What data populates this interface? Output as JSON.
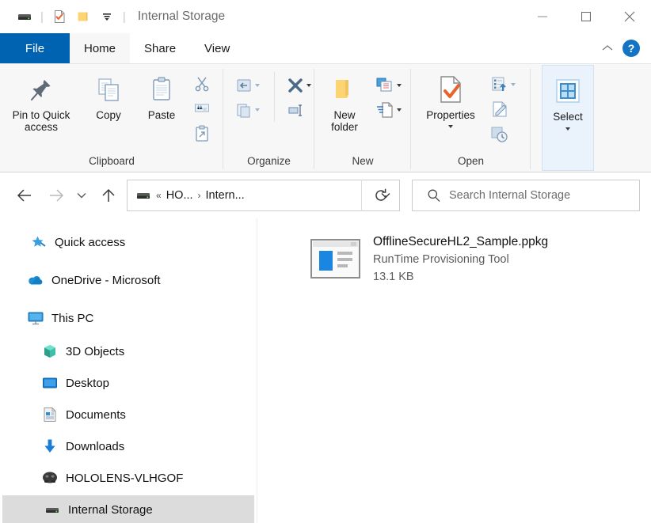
{
  "window": {
    "title": "Internal Storage",
    "controls": {
      "minimize": "minimize-button",
      "maximize": "maximize-button",
      "close": "close-button"
    }
  },
  "quick_access_toolbar": {
    "items": [
      {
        "name": "drive-icon",
        "label": "Internal Storage"
      },
      {
        "name": "properties-icon",
        "label": "Properties"
      },
      {
        "name": "new-folder-icon",
        "label": "New folder"
      },
      {
        "name": "customize-dropdown-icon",
        "label": "Customize Quick Access Toolbar"
      }
    ]
  },
  "ribbon": {
    "tabs": [
      {
        "label": "File",
        "active": false,
        "style": "file"
      },
      {
        "label": "Home",
        "active": true
      },
      {
        "label": "Share",
        "active": false
      },
      {
        "label": "View",
        "active": false
      }
    ],
    "collapse_label": "^",
    "help_label": "?",
    "groups": [
      {
        "label": "Clipboard",
        "big_buttons": [
          {
            "label": "Pin to Quick\naccess",
            "line1": "Pin to Quick",
            "line2": "access",
            "icon": "pin-icon"
          },
          {
            "label": "Copy",
            "icon": "copy-icon"
          },
          {
            "label": "Paste",
            "icon": "paste-icon"
          }
        ],
        "small_buttons": [
          {
            "label": "Cut",
            "icon": "cut-icon"
          },
          {
            "label": "Copy path",
            "icon": "copy-path-icon"
          },
          {
            "label": "Paste shortcut",
            "icon": "paste-shortcut-icon"
          }
        ]
      },
      {
        "label": "Organize",
        "small_buttons": [
          {
            "label": "Move to",
            "icon": "move-to-icon"
          },
          {
            "label": "Copy to",
            "icon": "copy-to-icon"
          },
          {
            "label": "Delete",
            "icon": "delete-icon"
          },
          {
            "label": "Rename",
            "icon": "rename-icon"
          }
        ]
      },
      {
        "label": "New",
        "big_buttons": [
          {
            "label": "New folder",
            "line1": "New",
            "line2": "folder",
            "icon": "new-folder-icon"
          }
        ],
        "small_buttons": [
          {
            "label": "New item",
            "icon": "new-item-icon"
          },
          {
            "label": "Easy access",
            "icon": "easy-access-icon"
          }
        ]
      },
      {
        "label": "Open",
        "big_buttons": [
          {
            "label": "Properties",
            "icon": "properties-icon"
          }
        ],
        "small_buttons": [
          {
            "label": "Open",
            "icon": "open-icon"
          },
          {
            "label": "Edit",
            "icon": "edit-icon"
          },
          {
            "label": "History",
            "icon": "history-icon"
          }
        ]
      },
      {
        "label": "",
        "highlighted": true,
        "big_buttons": [
          {
            "label": "Select",
            "icon": "select-icon"
          }
        ]
      }
    ]
  },
  "navigation": {
    "back_label": "Back",
    "forward_label": "Forward",
    "recent_label": "Recent locations",
    "up_label": "Up",
    "refresh_label": "Refresh",
    "breadcrumb": {
      "drive_icon": "drive-icon",
      "overflow": "«",
      "segments": [
        "HO...",
        "Intern..."
      ],
      "separator": "›",
      "dropdown_icon": "chevron-down-icon"
    }
  },
  "search": {
    "icon": "search-icon",
    "placeholder": "Search Internal Storage",
    "value": ""
  },
  "sidebar": {
    "items": [
      {
        "label": "Quick access",
        "icon": "star-pin-icon",
        "indent": 0,
        "selected": false
      },
      {
        "label": "OneDrive - Microsoft",
        "icon": "onedrive-icon",
        "indent": 0,
        "selected": false
      },
      {
        "label": "This PC",
        "icon": "this-pc-icon",
        "indent": 0,
        "selected": false
      },
      {
        "label": "3D Objects",
        "icon": "3d-objects-icon",
        "indent": 1,
        "selected": false
      },
      {
        "label": "Desktop",
        "icon": "desktop-icon",
        "indent": 1,
        "selected": false
      },
      {
        "label": "Documents",
        "icon": "documents-icon",
        "indent": 1,
        "selected": false
      },
      {
        "label": "Downloads",
        "icon": "downloads-icon",
        "indent": 1,
        "selected": false
      },
      {
        "label": "HOLOLENS-VLHGOF",
        "icon": "hololens-icon",
        "indent": 1,
        "selected": false
      },
      {
        "label": "Internal Storage",
        "icon": "drive-icon",
        "indent": 2,
        "selected": true
      }
    ]
  },
  "file_list": {
    "items": [
      {
        "name": "OfflineSecureHL2_Sample.ppkg",
        "description": "RunTime Provisioning Tool",
        "size": "13.1 KB",
        "icon": "ppkg-file-icon"
      }
    ]
  },
  "colors": {
    "file_tab_blue": "#0063b1",
    "accent_blue": "#1474c4",
    "selection_gray": "#dcdcdc",
    "ribbon_bg": "#f7f7f7",
    "select_highlight": "#eaf3fb",
    "folder_yellow": "#fcd572",
    "orange_check": "#e8622c"
  }
}
